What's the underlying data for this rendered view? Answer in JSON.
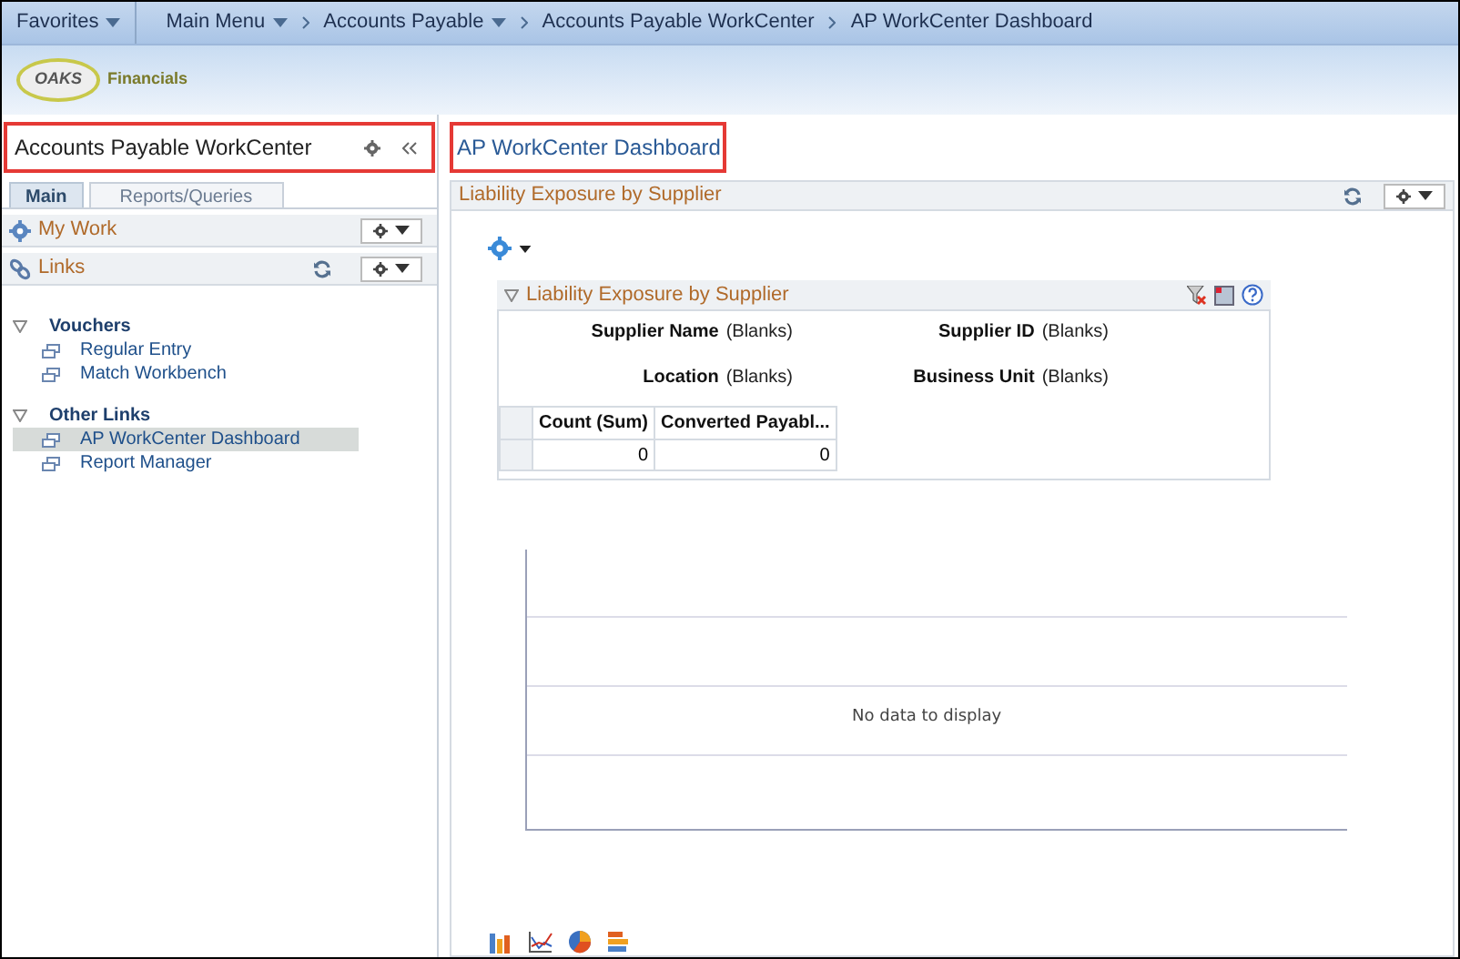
{
  "nav": {
    "favorites": "Favorites",
    "breadcrumbs": [
      {
        "label": "Main Menu",
        "has_menu": true
      },
      {
        "label": "Accounts Payable",
        "has_menu": true
      },
      {
        "label": "Accounts Payable WorkCenter",
        "has_menu": false
      },
      {
        "label": "AP WorkCenter Dashboard",
        "has_menu": false
      }
    ]
  },
  "logo": {
    "mark": "OAKS",
    "name": "Financials"
  },
  "workcenter": {
    "title": "Accounts Payable WorkCenter",
    "tabs": [
      {
        "label": "Main",
        "selected": true
      },
      {
        "label": "Reports/Queries",
        "selected": false
      }
    ],
    "sections": [
      {
        "title": "My Work",
        "kind": "work",
        "refresh": false
      },
      {
        "title": "Links",
        "kind": "links",
        "refresh": true
      }
    ],
    "groups": [
      {
        "title": "Vouchers",
        "expanded": true,
        "items": [
          {
            "label": "Regular Entry",
            "selected": false
          },
          {
            "label": "Match Workbench",
            "selected": false
          }
        ]
      },
      {
        "title": "Other Links",
        "expanded": true,
        "items": [
          {
            "label": "AP WorkCenter Dashboard",
            "selected": true
          },
          {
            "label": "Report Manager",
            "selected": false
          }
        ]
      }
    ]
  },
  "dashboard": {
    "title": "AP WorkCenter Dashboard",
    "pagelet": {
      "title": "Liability Exposure by Supplier",
      "pivot": {
        "title": "Liability Exposure by Supplier",
        "expanded": true,
        "filters": [
          {
            "label": "Supplier Name",
            "value": "(Blanks)"
          },
          {
            "label": "Supplier ID",
            "value": "(Blanks)"
          },
          {
            "label": "Location",
            "value": "(Blanks)"
          },
          {
            "label": "Business Unit",
            "value": "(Blanks)"
          }
        ],
        "columns": [
          "Count (Sum)",
          "Converted Payabl..."
        ],
        "rows": [
          [
            "0",
            "0"
          ]
        ]
      },
      "chart_message": "No data to display"
    }
  }
}
